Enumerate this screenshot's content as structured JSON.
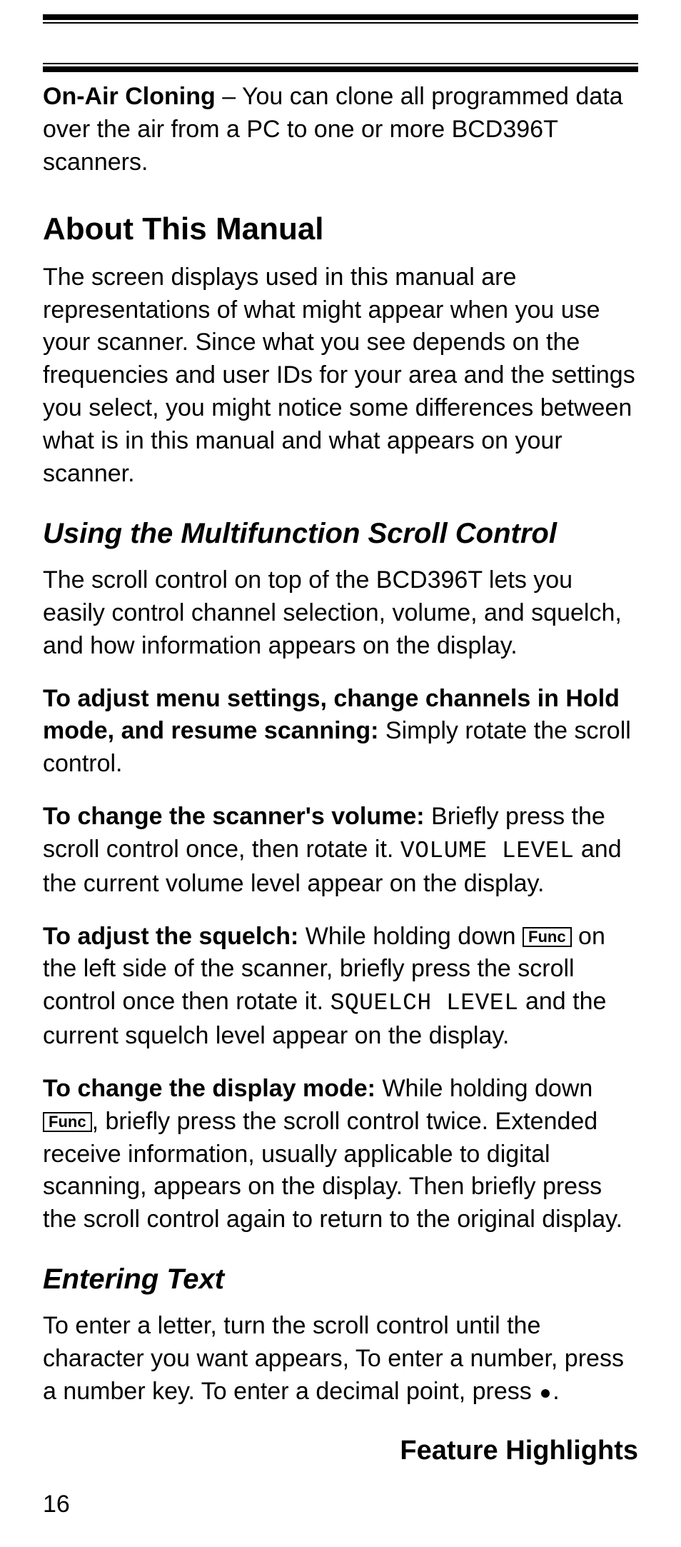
{
  "feature": {
    "title": "On-Air Cloning",
    "desc": " – You can clone all programmed data over the air from a PC to one or more BCD396T scanners."
  },
  "sections": {
    "about": {
      "heading": "About This Manual",
      "p1": "The screen displays used in this manual are representations of what might appear when you use your scanner. Since what you see depends on the frequencies and user IDs for your area and the settings you select, you might notice some differences between what is in this manual and what appears on your scanner."
    },
    "scroll": {
      "heading": "Using the Multifunction Scroll Control",
      "p1": "The scroll control on top of the BCD396T lets you easily control channel selection, volume, and squelch, and how information appears on the display.",
      "p2_bold": "To adjust menu settings, change channels in Hold mode, and resume scanning:",
      "p2_rest": " Simply rotate the scroll control.",
      "p3_bold": "To change the scanner's volume:",
      "p3_a": " Briefly press the scroll control once, then rotate it. ",
      "p3_mono": "VOLUME LEVEL",
      "p3_b": " and the current volume level appear on the display.",
      "p4_bold": "To adjust the squelch:",
      "p4_a": " While holding down ",
      "func_label": "Func",
      "p4_b": " on the left side of the scanner, briefly press the scroll control once then rotate it. ",
      "p4_mono": "SQUELCH LEVEL",
      "p4_c": " and the current squelch level appear on the display.",
      "p5_bold": "To change the display mode:",
      "p5_a": " While holding down ",
      "p5_b": ", briefly press the scroll control twice. Extended receive information, usually applicable to digital scanning, appears on the display. Then briefly press the scroll control again to return to the original display."
    },
    "text": {
      "heading": "Entering Text",
      "p1_a": "To enter a letter, turn the scroll control until the character you want appears, To enter a number, press a number key. To enter a decimal point, press ",
      "p1_b": "."
    }
  },
  "footer": {
    "section_title": "Feature Highlights",
    "page_number": "16"
  }
}
